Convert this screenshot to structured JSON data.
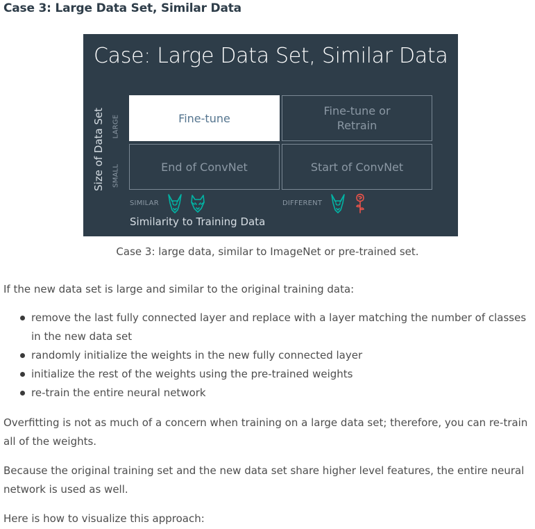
{
  "heading": "Case 3: Large Data Set, Similar Data",
  "figure": {
    "title": "Case: Large Data Set, Similar Data",
    "y_axis_label": "Size of Data Set",
    "y_ticks": {
      "large": "LARGE",
      "small": "SMALL"
    },
    "x_axis_label": "Similarity to Training Data",
    "x_ticks": {
      "similar": "SIMILAR",
      "different": "DIFFERENT"
    },
    "cells": {
      "large_similar": "Fine-tune",
      "large_different": "Fine-tune or Retrain",
      "small_similar": "End of ConvNet",
      "small_different": "Start of ConvNet"
    },
    "highlighted_cell": "large_similar",
    "colors": {
      "background": "#2e3d49",
      "highlight_bg": "#ffffff",
      "highlight_text": "#55758f",
      "dog_icon": "#02b3a4",
      "rose_icon": "#e8534a"
    },
    "icons": [
      "dog-icon",
      "wolf-icon",
      "dog-icon",
      "rose-icon"
    ]
  },
  "caption": "Case 3: large data, similar to ImageNet or pre-trained set.",
  "intro": "If the new data set is large and similar to the original training data:",
  "bullets": [
    "remove the last fully connected layer and replace with a layer matching the number of classes in the new data set",
    "randomly initialize the weights in the new fully connected layer",
    "initialize the rest of the weights using the pre-trained weights",
    "re-train the entire neural network"
  ],
  "paragraphs": [
    "Overfitting is not as much of a concern when training on a large data set; therefore, you can re-train all of the weights.",
    "Because the original training set and the new data set share higher level features, the entire neural network is used as well.",
    "Here is how to visualize this approach:"
  ]
}
